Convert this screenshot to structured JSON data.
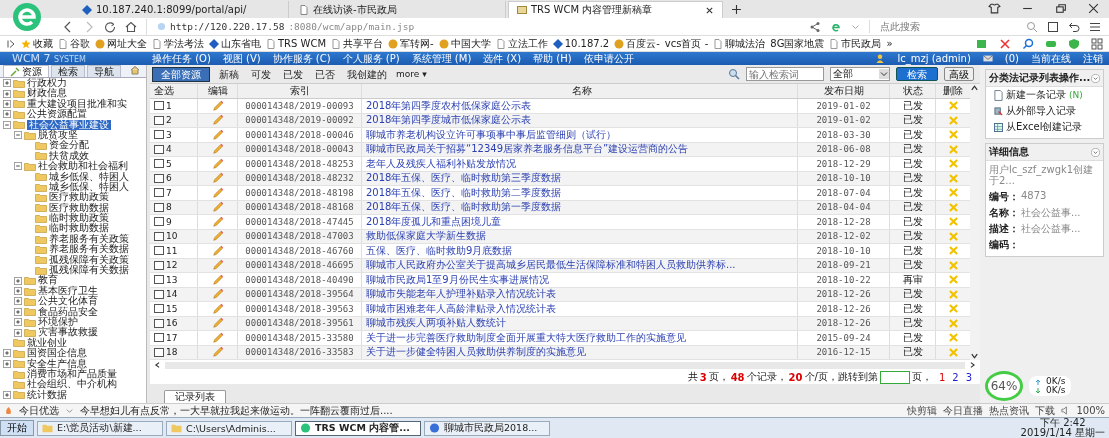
{
  "browser": {
    "tabs": [
      {
        "title": "10.187.240.1:8099/portal/api/",
        "selected": false
      },
      {
        "title": "在线访谈-市民政局",
        "selected": false
      },
      {
        "title": "TRS WCM 内容管理新稿章",
        "selected": true
      }
    ],
    "address_host": "http://120.220.17.58",
    "address_rest": ":8080/wcm/app/main.jsp",
    "search_placeholder": "点此搜索",
    "bookmarks": [
      "收藏",
      "谷歌",
      "网址大全",
      "学法考法",
      "山东省电",
      "TRS WCM",
      "共享平台",
      "军转网-",
      "中国大学",
      "立法工作",
      "10.187.2",
      "百度云-",
      "vcs首页 -",
      "聊城法治",
      "8G国家地震",
      "市民政局",
      "»"
    ]
  },
  "wcm": {
    "logo": "WCM 7",
    "logo_sub": "SYSTEM",
    "menu": [
      "操作任务 (O)",
      "视图 (V)",
      "协作服务 (C)",
      "个人服务 (P)",
      "系统管理 (M)",
      "选件 (X)",
      "帮助 (H)",
      "依申请公开"
    ],
    "user": "lc_mzj (admin)",
    "messages": "(0)",
    "online": "当前在线",
    "logout": "注销"
  },
  "sidebar": {
    "tabs": [
      {
        "label": "资源",
        "selected": true
      },
      {
        "label": "检索",
        "selected": false
      },
      {
        "label": "导航",
        "selected": false
      }
    ],
    "tree": [
      {
        "label": "行政权力",
        "kind": "branch",
        "expanded": false,
        "selected": false
      },
      {
        "label": "财政信息",
        "kind": "branch",
        "expanded": false,
        "selected": false
      },
      {
        "label": "重大建设项目批准和实",
        "kind": "branch",
        "expanded": false,
        "selected": false
      },
      {
        "label": "公共资源配置",
        "kind": "branch",
        "expanded": false,
        "selected": false
      },
      {
        "label": "社会公益事业建设",
        "kind": "branch",
        "expanded": true,
        "selected": true,
        "children": [
          {
            "label": "脱贫攻坚",
            "kind": "branch",
            "expanded": true,
            "selected": false,
            "children": [
              {
                "label": "资金分配",
                "kind": "leaf",
                "selected": false
              },
              {
                "label": "扶贫成效",
                "kind": "leaf",
                "selected": false
              }
            ]
          },
          {
            "label": "社会救助和社会福利",
            "kind": "branch",
            "expanded": true,
            "selected": false,
            "children": [
              {
                "label": "城乡低保、特困人",
                "kind": "leaf",
                "selected": false
              },
              {
                "label": "城乡低保、特困人",
                "kind": "leaf",
                "selected": false
              },
              {
                "label": "医疗救助政策",
                "kind": "leaf",
                "selected": false
              },
              {
                "label": "医疗救助数据",
                "kind": "leaf",
                "selected": false
              },
              {
                "label": "临时救助政策",
                "kind": "leaf",
                "selected": false
              },
              {
                "label": "临时救助数据",
                "kind": "leaf",
                "selected": false
              },
              {
                "label": "养老服务有关政策",
                "kind": "leaf",
                "selected": false
              },
              {
                "label": "养老服务有关数据",
                "kind": "leaf",
                "selected": false
              },
              {
                "label": "孤残保障有关政策",
                "kind": "leaf",
                "selected": false
              },
              {
                "label": "孤残保障有关数据",
                "kind": "leaf",
                "selected": false
              }
            ]
          },
          {
            "label": "教育",
            "kind": "branch",
            "expanded": false,
            "selected": false
          },
          {
            "label": "基本医疗卫生",
            "kind": "branch",
            "expanded": false,
            "selected": false
          },
          {
            "label": "公共文化体育",
            "kind": "branch",
            "expanded": false,
            "selected": false
          },
          {
            "label": "食品药品安全",
            "kind": "branch",
            "expanded": false,
            "selected": false
          },
          {
            "label": "环境保护",
            "kind": "branch",
            "expanded": false,
            "selected": false
          },
          {
            "label": "灾害事故救援",
            "kind": "branch",
            "expanded": false,
            "selected": false
          }
        ]
      },
      {
        "label": "就业创业",
        "kind": "leaf",
        "selected": false
      },
      {
        "label": "国资国企信息",
        "kind": "branch",
        "expanded": false,
        "selected": false
      },
      {
        "label": "安全生产信息",
        "kind": "branch",
        "expanded": false,
        "selected": false
      },
      {
        "label": "消费市场和产品质量",
        "kind": "leaf",
        "selected": false
      },
      {
        "label": "社会组织、中介机构",
        "kind": "leaf",
        "selected": false
      },
      {
        "label": "统计数据",
        "kind": "branch",
        "expanded": false,
        "selected": false
      }
    ]
  },
  "filters": [
    {
      "label": "全部资源",
      "selected": true
    },
    {
      "label": "新稿",
      "selected": false
    },
    {
      "label": "可发",
      "selected": false
    },
    {
      "label": "已发",
      "selected": false
    },
    {
      "label": "已否",
      "selected": false
    },
    {
      "label": "我创建的",
      "selected": false
    }
  ],
  "more": "more",
  "more_caret": "▾",
  "search": {
    "placeholder": "输入检索词",
    "scope": "全部",
    "button": "检索",
    "advanced": "高级"
  },
  "table": {
    "columns": [
      "全选",
      "编辑",
      "索引",
      "名称",
      "发布日期",
      "状态",
      "删除"
    ],
    "rows": [
      {
        "number": "1",
        "checked": false,
        "index": "000014348/2019-00093",
        "title": "2018年第四季度农村低保家庭公示表",
        "date": "2019-01-02",
        "status": "已发"
      },
      {
        "number": "2",
        "checked": false,
        "index": "000014348/2019-00092",
        "title": "2018年第四季度城市低保家庭公示表",
        "date": "2019-01-02",
        "status": "已发"
      },
      {
        "number": "3",
        "checked": false,
        "index": "000014348/2018-00046",
        "title": "聊城市养老机构设立许可事项事中事后监管细则（试行）",
        "date": "2018-03-30",
        "status": "已发"
      },
      {
        "number": "4",
        "checked": false,
        "index": "000014348/2018-00043",
        "title": "聊城市民政局关于招募“12349居家养老服务信息平台”建设运营商的公告",
        "date": "2018-06-08",
        "status": "已发"
      },
      {
        "number": "5",
        "checked": false,
        "index": "000014348/2018-48253",
        "title": "老年人及残疾人福利补贴发放情况",
        "date": "2018-12-29",
        "status": "已发"
      },
      {
        "number": "6",
        "checked": false,
        "index": "000014348/2018-48232",
        "title": "2018年五保、医疗、临时救助第三季度数据",
        "date": "2018-10-10",
        "status": "已发"
      },
      {
        "number": "7",
        "checked": false,
        "index": "000014348/2018-48198",
        "title": "2018年五保、医疗、临时救助第二季度数据",
        "date": "2018-07-04",
        "status": "已发"
      },
      {
        "number": "8",
        "checked": false,
        "index": "000014348/2018-48168",
        "title": "2018年五保、医疗、临时救助第一季度数据",
        "date": "2018-04-04",
        "status": "已发"
      },
      {
        "number": "9",
        "checked": false,
        "index": "000014348/2018-47445",
        "title": "2018年度孤儿和重点困境儿童",
        "date": "2018-12-28",
        "status": "已发"
      },
      {
        "number": "10",
        "checked": false,
        "index": "000014348/2018-47003",
        "title": "救助低保家庭大学新生数据",
        "date": "2018-12-02",
        "status": "已发"
      },
      {
        "number": "11",
        "checked": false,
        "index": "000014348/2018-46760",
        "title": "五保、医疗、临时救助9月底数据",
        "date": "2018-10-10",
        "status": "已发"
      },
      {
        "number": "12",
        "checked": false,
        "index": "000014348/2018-46695",
        "title": "聊城市人民政府办公室关于提高城乡居民最低生活保障标准和特困人员救助供养标...",
        "date": "2018-09-21",
        "status": "已发"
      },
      {
        "number": "13",
        "checked": false,
        "index": "000014348/2018-40490",
        "title": "聊城市民政局1至9月份民生实事进展情况",
        "date": "2018-10-22",
        "status": "再审"
      },
      {
        "number": "14",
        "checked": false,
        "index": "000014348/2018-39564",
        "title": "聊城市失能老年人护理补贴录入情况统计表",
        "date": "2018-12-26",
        "status": "已发"
      },
      {
        "number": "15",
        "checked": false,
        "index": "000014348/2018-39563",
        "title": "聊城市困难老年人高龄津贴录入情况统计表",
        "date": "2018-12-26",
        "status": "已发"
      },
      {
        "number": "16",
        "checked": false,
        "index": "000014348/2018-39561",
        "title": "聊城市残疾人两项补贴人数统计",
        "date": "2018-12-26",
        "status": "已发"
      },
      {
        "number": "17",
        "checked": false,
        "index": "000014348/2015-33580",
        "title": "关于进一步完善医疗救助制度全面开展重大特大医疗救助工作的实施意见",
        "date": "2015-09-24",
        "status": "已发"
      },
      {
        "number": "18",
        "checked": false,
        "index": "000014348/2016-33583",
        "title": "关于进一步健全特困人员救助供养制度的实施意见",
        "date": "2016-12-15",
        "status": "已发"
      }
    ]
  },
  "pagination": {
    "parts": [
      {
        "text": "共",
        "kind": "plain"
      },
      {
        "text": "3",
        "kind": "number"
      },
      {
        "text": "页，",
        "kind": "plain"
      },
      {
        "text": "48",
        "kind": "number"
      },
      {
        "text": "个记录，",
        "kind": "plain"
      },
      {
        "text": "20",
        "kind": "number"
      },
      {
        "text": "个/页，跳转到第",
        "kind": "plain"
      }
    ],
    "after": "页，",
    "pages": [
      {
        "label": "1",
        "selected": true
      },
      {
        "label": "2",
        "selected": false
      },
      {
        "label": "3",
        "selected": false
      }
    ]
  },
  "bottom_tab": "记录列表",
  "actions": {
    "title": "分类法记录列表操作...",
    "items": [
      {
        "label": "新建一条记录",
        "shortcut": "(N)"
      },
      {
        "label": "从外部导入记录"
      },
      {
        "label": "从Excel创建记录"
      }
    ]
  },
  "details": {
    "title": "详细信息",
    "created": "用户lc_szf_zwgk1创建于2...",
    "fields": [
      {
        "label": "编号：",
        "value": "4873"
      },
      {
        "label": "名称：",
        "value": "社会公益事..."
      },
      {
        "label": "描述：",
        "value": "社会公益事..."
      },
      {
        "label": "编码："
      }
    ]
  },
  "speed": {
    "percent": "64%",
    "up": "0K/s",
    "down": "0K/s"
  },
  "newsbar": {
    "label": "今日优选",
    "headline": "今早想妇儿有点反常，一大早就拉我起来做运动。一阵翻云覆雨过后....",
    "tools": [
      "快剪辑",
      "今日直播",
      "热点资讯",
      "下载"
    ],
    "zoom": "100%"
  },
  "taskbar": {
    "start": "开始",
    "items": [
      {
        "label": "E:\\党员活动\\新建...",
        "selected": false
      },
      {
        "label": "C:\\Users\\Adminis...",
        "selected": false
      },
      {
        "label": "TRS WCM 内容管...",
        "selected": true
      },
      {
        "label": "聊城市民政局2018...",
        "selected": false
      }
    ],
    "time": "下午 2:42",
    "date": "2019/1/14 星期一"
  }
}
